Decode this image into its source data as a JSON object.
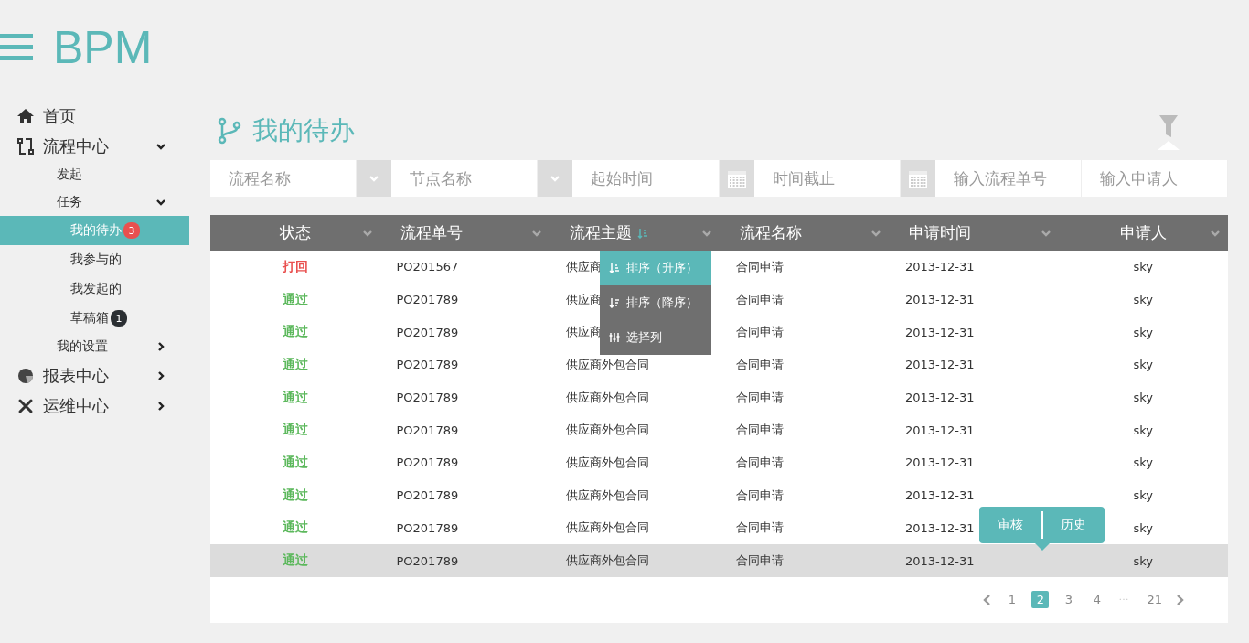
{
  "brand": "BPM",
  "nav": [
    {
      "label": "首页",
      "selected": false
    },
    {
      "label": "流程中心",
      "selected": false,
      "expanded": true,
      "children": [
        {
          "label": "发起",
          "selected": false
        },
        {
          "label": "任务",
          "selected": false,
          "expanded": true,
          "children": [
            {
              "label": "我的待办",
              "selected": true,
              "badge": "3",
              "color": "#e9504f"
            },
            {
              "label": "我参与的",
              "selected": false
            },
            {
              "label": "我发起的",
              "selected": false
            },
            {
              "label": "草稿箱",
              "selected": false,
              "badge": "1",
              "color": "#2b2f33"
            }
          ]
        },
        {
          "label": "我的设置",
          "selected": false,
          "expanded": false
        }
      ]
    },
    {
      "label": "报表中心",
      "selected": false,
      "expanded": false
    },
    {
      "label": "运维中心",
      "selected": false,
      "expanded": false
    }
  ],
  "page_title": "我的待办",
  "filters": [
    {
      "kind": "select",
      "placeholder": "流程名称"
    },
    {
      "kind": "select",
      "placeholder": "节点名称"
    },
    {
      "kind": "date",
      "placeholder": "起始时间"
    },
    {
      "kind": "date",
      "placeholder": "时间截止"
    },
    {
      "kind": "text",
      "placeholder": "输入流程单号"
    },
    {
      "kind": "text",
      "placeholder": "输入申请人"
    }
  ],
  "table": {
    "columns": [
      {
        "label": "状态",
        "sorted": false
      },
      {
        "label": "流程单号",
        "sorted": false
      },
      {
        "label": "流程主题",
        "sorted": true
      },
      {
        "label": "流程名称",
        "sorted": false
      },
      {
        "label": "申请时间",
        "sorted": false
      },
      {
        "label": "申请人",
        "sorted": false
      }
    ],
    "rows": [
      {
        "selected": false,
        "color": "#e9504f",
        "cells": [
          "打回",
          "PO201567",
          "供应商",
          "合同申请",
          "2013-12-31",
          "sky"
        ]
      },
      {
        "selected": false,
        "color": "#5cb85c",
        "cells": [
          "通过",
          "PO201789",
          "供应商",
          "合同申请",
          "2013-12-31",
          "sky"
        ]
      },
      {
        "selected": false,
        "color": "#5cb85c",
        "cells": [
          "通过",
          "PO201789",
          "供应商",
          "合同申请",
          "2013-12-31",
          "sky"
        ]
      },
      {
        "selected": false,
        "color": "#5cb85c",
        "cells": [
          "通过",
          "PO201789",
          "供应商外包合同",
          "合同申请",
          "2013-12-31",
          "sky"
        ]
      },
      {
        "selected": false,
        "color": "#5cb85c",
        "cells": [
          "通过",
          "PO201789",
          "供应商外包合同",
          "合同申请",
          "2013-12-31",
          "sky"
        ]
      },
      {
        "selected": false,
        "color": "#5cb85c",
        "cells": [
          "通过",
          "PO201789",
          "供应商外包合同",
          "合同申请",
          "2013-12-31",
          "sky"
        ]
      },
      {
        "selected": false,
        "color": "#5cb85c",
        "cells": [
          "通过",
          "PO201789",
          "供应商外包合同",
          "合同申请",
          "2013-12-31",
          "sky"
        ]
      },
      {
        "selected": false,
        "color": "#5cb85c",
        "cells": [
          "通过",
          "PO201789",
          "供应商外包合同",
          "合同申请",
          "2013-12-31",
          "sky"
        ]
      },
      {
        "selected": false,
        "color": "#5cb85c",
        "cells": [
          "通过",
          "PO201789",
          "供应商外包合同",
          "合同申请",
          "2013-12-31",
          "sky"
        ]
      },
      {
        "selected": true,
        "color": "#5cb85c",
        "cells": [
          "通过",
          "PO201789",
          "供应商外包合同",
          "合同申请",
          "2013-12-31",
          "sky"
        ]
      }
    ]
  },
  "column_menu": [
    {
      "kind": "asc",
      "label": "排序（升序）",
      "selected": true
    },
    {
      "kind": "desc",
      "label": "排序（降序）",
      "selected": false
    },
    {
      "kind": "columns",
      "label": "选择列",
      "selected": false
    }
  ],
  "row_actions": [
    "审核",
    "历史"
  ],
  "pagination": {
    "pages": [
      {
        "label": "1",
        "selected": false
      },
      {
        "label": "2",
        "selected": true
      },
      {
        "label": "3",
        "selected": false
      },
      {
        "label": "4",
        "selected": false
      },
      {
        "label": "…",
        "selected": false,
        "kind": "gap"
      },
      {
        "label": "21",
        "selected": false
      }
    ]
  }
}
